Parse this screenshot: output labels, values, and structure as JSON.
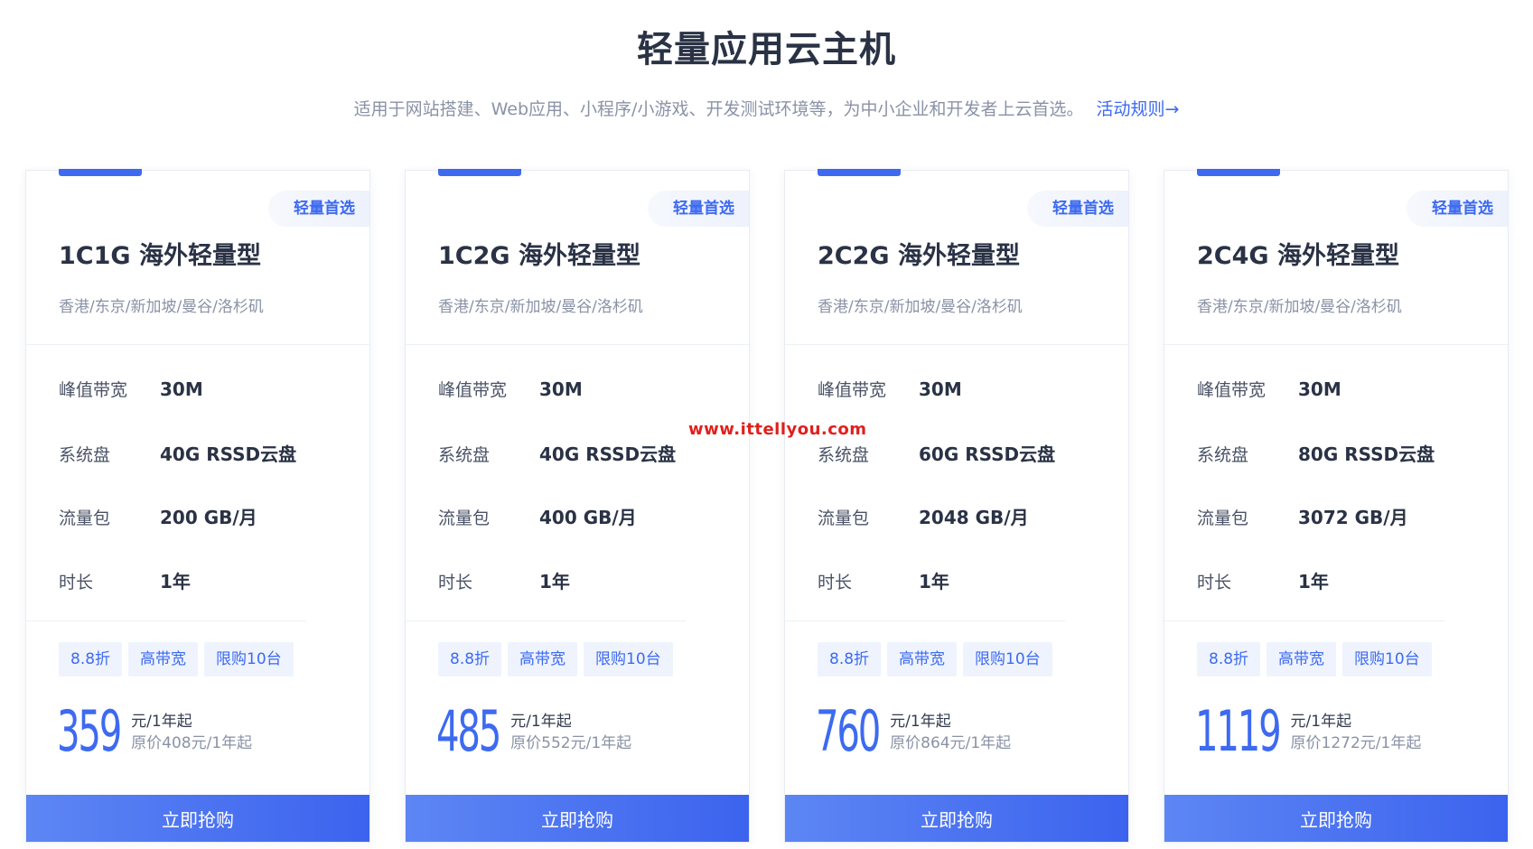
{
  "header": {
    "title": "轻量应用云主机",
    "subtitle": "适用于网站搭建、Web应用、小程序/小游戏、开发测试环境等，为中小企业和开发者上云首选。",
    "rules_link": "活动规则→"
  },
  "watermark": "www.ittellyou.com",
  "spec_labels": {
    "bandwidth": "峰值带宽",
    "disk": "系统盘",
    "traffic": "流量包",
    "duration": "时长"
  },
  "plans": [
    {
      "badge": "轻量首选",
      "name": "1C1G 海外轻量型",
      "regions": "香港/东京/新加坡/曼谷/洛杉矶",
      "bandwidth": "30M",
      "disk": "40G RSSD云盘",
      "traffic": "200 GB/月",
      "duration": "1年",
      "tags": [
        "8.8折",
        "高带宽",
        "限购10台"
      ],
      "price": "359",
      "price_unit": "元/1年起",
      "original_price": "原价408元/1年起",
      "buy_label": "立即抢购"
    },
    {
      "badge": "轻量首选",
      "name": "1C2G 海外轻量型",
      "regions": "香港/东京/新加坡/曼谷/洛杉矶",
      "bandwidth": "30M",
      "disk": "40G RSSD云盘",
      "traffic": "400 GB/月",
      "duration": "1年",
      "tags": [
        "8.8折",
        "高带宽",
        "限购10台"
      ],
      "price": "485",
      "price_unit": "元/1年起",
      "original_price": "原价552元/1年起",
      "buy_label": "立即抢购"
    },
    {
      "badge": "轻量首选",
      "name": "2C2G 海外轻量型",
      "regions": "香港/东京/新加坡/曼谷/洛杉矶",
      "bandwidth": "30M",
      "disk": "60G RSSD云盘",
      "traffic": "2048 GB/月",
      "duration": "1年",
      "tags": [
        "8.8折",
        "高带宽",
        "限购10台"
      ],
      "price": "760",
      "price_unit": "元/1年起",
      "original_price": "原价864元/1年起",
      "buy_label": "立即抢购"
    },
    {
      "badge": "轻量首选",
      "name": "2C4G 海外轻量型",
      "regions": "香港/东京/新加坡/曼谷/洛杉矶",
      "bandwidth": "30M",
      "disk": "80G RSSD云盘",
      "traffic": "3072 GB/月",
      "duration": "1年",
      "tags": [
        "8.8折",
        "高带宽",
        "限购10台"
      ],
      "price": "1119",
      "price_unit": "元/1年起",
      "original_price": "原价1272元/1年起",
      "buy_label": "立即抢购"
    }
  ]
}
